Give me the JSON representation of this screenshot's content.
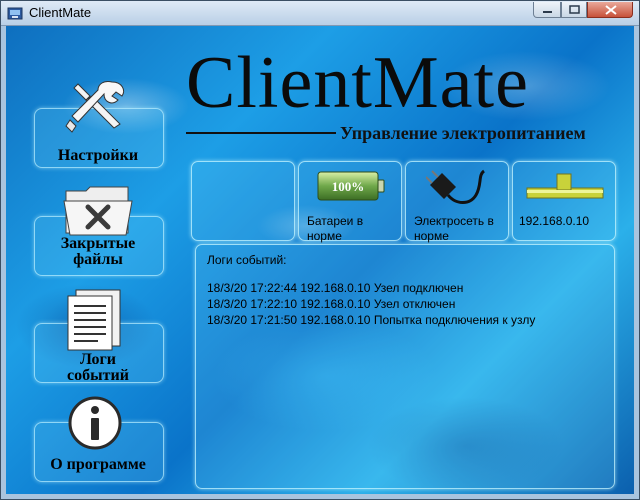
{
  "window": {
    "title": "ClientMate"
  },
  "header": {
    "logo": "ClientMate",
    "subtitle": "Управление электропитанием"
  },
  "sidebar": {
    "items": [
      {
        "label": "Настройки",
        "icon": "tools-icon"
      },
      {
        "label": "Закрытые файлы",
        "icon": "closed-folder-icon"
      },
      {
        "label": "Логи событий",
        "icon": "documents-icon"
      },
      {
        "label": "О программе",
        "icon": "info-icon"
      }
    ]
  },
  "status": {
    "battery": {
      "percent_label": "100%",
      "percent": 100,
      "text": "Батареи в норме",
      "color": "#6fa84a"
    },
    "power": {
      "text": "Электросеть в норме"
    },
    "node": {
      "text": "192.168.0.10",
      "color": "#c9d23a"
    }
  },
  "log": {
    "title": "Логи событий:",
    "entries": [
      "18/3/20 17:22:44 192.168.0.10 Узел подключен",
      "18/3/20 17:22:10 192.168.0.10 Узел отключен",
      "18/3/20 17:21:50 192.168.0.10 Попытка подключения к узлу"
    ]
  }
}
